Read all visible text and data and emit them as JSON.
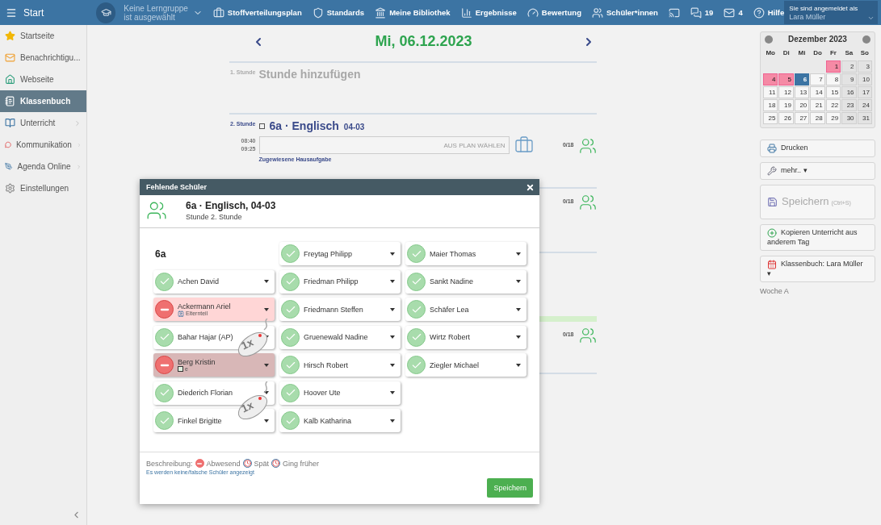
{
  "topbar": {
    "menu_label": "Start",
    "group": {
      "line1": "Keine Lerngruppe",
      "line2": "ist ausgewählt"
    },
    "nav": [
      {
        "kind": "briefcase",
        "label": "Stoffverteilungsplan"
      },
      {
        "kind": "shield",
        "label": "Standards"
      },
      {
        "kind": "library",
        "label": "Meine Bibliothek"
      },
      {
        "kind": "chart",
        "label": "Ergebnisse"
      },
      {
        "kind": "gauge",
        "label": "Bewertung"
      },
      {
        "kind": "walkers",
        "label": "Schüler*innen"
      },
      {
        "kind": "screen"
      },
      {
        "kind": "chat",
        "label": "19"
      },
      {
        "kind": "mail",
        "label": "4"
      },
      {
        "kind": "help",
        "label": "Hilfe"
      }
    ],
    "user": {
      "caption": "Sie sind angemeldet als",
      "name": "Lara Müller"
    }
  },
  "sidebar": {
    "items": [
      {
        "kind": "star",
        "label": "Startseite",
        "selected": false,
        "expandable": false
      },
      {
        "kind": "mail",
        "label": "Benachrichtigu...",
        "selected": false,
        "expandable": false
      },
      {
        "kind": "home",
        "label": "Webseite",
        "selected": false,
        "expandable": false
      },
      {
        "kind": "book",
        "label": "Klassenbuch",
        "selected": true,
        "expandable": false
      },
      {
        "kind": "lesson",
        "label": "Unterricht",
        "selected": false,
        "expandable": true
      },
      {
        "kind": "chat",
        "label": "Kommunikation",
        "selected": false,
        "expandable": true
      },
      {
        "kind": "pen",
        "label": "Agenda Online",
        "selected": false,
        "expandable": true
      },
      {
        "kind": "gear",
        "label": "Einstellungen",
        "selected": false,
        "expandable": false
      }
    ]
  },
  "day": {
    "title": "Mi, 06.12.2023"
  },
  "lessons": [
    {
      "kind": "empty",
      "period": "1. Stunde",
      "add_label": "Stunde hinzufügen"
    },
    {
      "kind": "lesson",
      "period": "2. Stunde",
      "title": "6a · Englisch",
      "room": "04-03",
      "start": "08:40",
      "end": "09:25",
      "plan_placeholder": "AUS PLAN WÄHLEN",
      "homework_label": "Zugewiesene Hausaufgabe",
      "count": "0/18"
    },
    {
      "kind": "hidden",
      "count": "0/18",
      "highlight": false
    },
    {
      "kind": "hidden",
      "highlight": false
    },
    {
      "kind": "hidden",
      "count": "0/18",
      "highlight": true
    },
    {
      "kind": "hidden",
      "highlight": false
    }
  ],
  "calendar": {
    "title": "Dezember 2023",
    "weekdays": [
      "Mo",
      "Di",
      "Mi",
      "Do",
      "Fr",
      "Sa",
      "So"
    ],
    "days": [
      {
        "kind": "blank"
      },
      {
        "kind": "blank"
      },
      {
        "kind": "blank"
      },
      {
        "kind": "blank"
      },
      {
        "kind": "day",
        "label": "1",
        "marked": true,
        "selected": false
      },
      {
        "kind": "day",
        "label": "2",
        "marked": false,
        "selected": false
      },
      {
        "kind": "day",
        "label": "3",
        "marked": false,
        "selected": false
      },
      {
        "kind": "day",
        "label": "4",
        "marked": true,
        "selected": false
      },
      {
        "kind": "day",
        "label": "5",
        "marked": true,
        "selected": false
      },
      {
        "kind": "day",
        "label": "6",
        "marked": false,
        "selected": true
      },
      {
        "kind": "day",
        "label": "7",
        "marked": false,
        "selected": false
      },
      {
        "kind": "day",
        "label": "8",
        "marked": false,
        "selected": false
      },
      {
        "kind": "day",
        "label": "9",
        "marked": false,
        "selected": false
      },
      {
        "kind": "day",
        "label": "10",
        "marked": false,
        "selected": false
      },
      {
        "kind": "day",
        "label": "11",
        "marked": false,
        "selected": false
      },
      {
        "kind": "day",
        "label": "12",
        "marked": false,
        "selected": false
      },
      {
        "kind": "day",
        "label": "13",
        "marked": false,
        "selected": false
      },
      {
        "kind": "day",
        "label": "14",
        "marked": false,
        "selected": false
      },
      {
        "kind": "day",
        "label": "15",
        "marked": false,
        "selected": false
      },
      {
        "kind": "day",
        "label": "16",
        "marked": false,
        "selected": false
      },
      {
        "kind": "day",
        "label": "17",
        "marked": false,
        "selected": false
      },
      {
        "kind": "day",
        "label": "18",
        "marked": false,
        "selected": false
      },
      {
        "kind": "day",
        "label": "19",
        "marked": false,
        "selected": false
      },
      {
        "kind": "day",
        "label": "20",
        "marked": false,
        "selected": false
      },
      {
        "kind": "day",
        "label": "21",
        "marked": false,
        "selected": false
      },
      {
        "kind": "day",
        "label": "22",
        "marked": false,
        "selected": false
      },
      {
        "kind": "day",
        "label": "23",
        "marked": false,
        "selected": false
      },
      {
        "kind": "day",
        "label": "24",
        "marked": false,
        "selected": false
      },
      {
        "kind": "day",
        "label": "25",
        "marked": false,
        "selected": false
      },
      {
        "kind": "day",
        "label": "26",
        "marked": false,
        "selected": false
      },
      {
        "kind": "day",
        "label": "27",
        "marked": false,
        "selected": false
      },
      {
        "kind": "day",
        "label": "28",
        "marked": false,
        "selected": false
      },
      {
        "kind": "day",
        "label": "29",
        "marked": false,
        "selected": false
      },
      {
        "kind": "day",
        "label": "30",
        "marked": false,
        "selected": false
      },
      {
        "kind": "day",
        "label": "31",
        "marked": false,
        "selected": false
      }
    ]
  },
  "actions": [
    {
      "kind": "print",
      "label": "Drucken"
    },
    {
      "kind": "tools",
      "label": "mehr.. ▾"
    },
    {
      "kind": "save",
      "label": "Speichern",
      "hint": "(Ctrl+S)"
    },
    {
      "kind": "copy",
      "label": "Kopieren Unterricht aus anderem Tag"
    },
    {
      "kind": "calendar",
      "label": "Klassenbuch: Lara Müller ▾"
    }
  ],
  "week": "Woche A",
  "dialog": {
    "title": "Fehlende Schüler",
    "heading": "6a · Englisch, 04-03",
    "subheading": "Stunde 2. Stunde",
    "group": "6a",
    "students": [
      {
        "name": "Achen David",
        "kind": "present",
        "selected": false
      },
      {
        "name": "Ackermann Ariel",
        "kind": "absent",
        "selected": false,
        "note": {
          "kind": "parent",
          "text": "Elternteil"
        }
      },
      {
        "name": "Bahar Hajar (AP)",
        "kind": "present",
        "selected": false
      },
      {
        "name": "Berg Kristin",
        "kind": "absent",
        "selected": true,
        "note": {
          "kind": "checkbox",
          "checked": false,
          "text": "e"
        }
      },
      {
        "name": "Diederich Florian",
        "kind": "present",
        "selected": false
      },
      {
        "name": "Finkel Brigitte",
        "kind": "present",
        "selected": false
      },
      {
        "name": "Freytag Philipp",
        "kind": "present",
        "selected": false
      },
      {
        "name": "Friedman Philipp",
        "kind": "present",
        "selected": false
      },
      {
        "name": "Friedmann Steffen",
        "kind": "present",
        "selected": false
      },
      {
        "name": "Gruenewald Nadine",
        "kind": "present",
        "selected": false
      },
      {
        "name": "Hirsch Robert",
        "kind": "present",
        "selected": false
      },
      {
        "name": "Hoover Ute",
        "kind": "present",
        "selected": false
      },
      {
        "name": "Kalb Katharina",
        "kind": "present",
        "selected": false
      },
      {
        "name": "Maier Thomas",
        "kind": "present",
        "selected": false
      },
      {
        "name": "Sankt Nadine",
        "kind": "present",
        "selected": false
      },
      {
        "name": "Schäfer Lea",
        "kind": "present",
        "selected": false
      },
      {
        "name": "Wirtz Robert",
        "kind": "present",
        "selected": false
      },
      {
        "name": "Ziegler Michael",
        "kind": "present",
        "selected": false
      }
    ],
    "legend": {
      "label": "Beschreibung:",
      "items": [
        {
          "kind": "absent",
          "label": "Abwesend"
        },
        {
          "kind": "late",
          "label": "Spät"
        },
        {
          "kind": "early",
          "label": "Ging früher"
        }
      ]
    },
    "link": "Es werden keine/falsche Schüler angezeigt",
    "save": "Speichern",
    "click_hints": [
      {
        "label": "1x"
      },
      {
        "label": "1x"
      }
    ]
  }
}
